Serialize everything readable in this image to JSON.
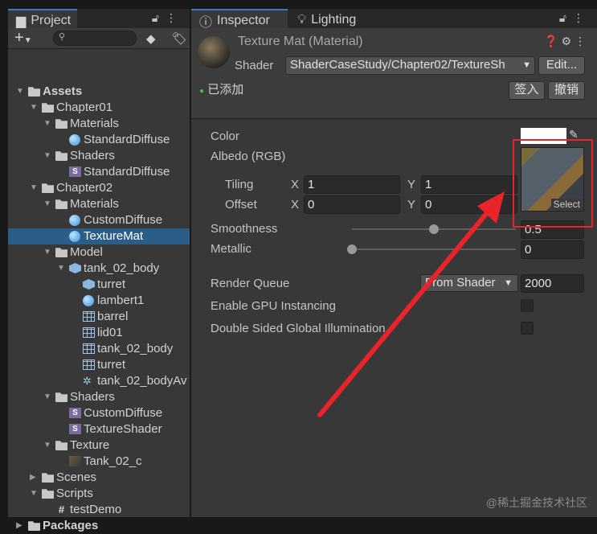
{
  "project": {
    "tab": "Project",
    "search_placeholder": "",
    "tree": [
      {
        "label": "Assets",
        "level": 0,
        "arrow": "open",
        "icon": "folder",
        "bold": true
      },
      {
        "label": "Chapter01",
        "level": 1,
        "arrow": "open",
        "icon": "folder"
      },
      {
        "label": "Materials",
        "level": 2,
        "arrow": "open",
        "icon": "folder"
      },
      {
        "label": "StandardDiffuse",
        "level": 3,
        "icon": "material"
      },
      {
        "label": "Shaders",
        "level": 2,
        "arrow": "open",
        "icon": "folder"
      },
      {
        "label": "StandardDiffuse",
        "level": 3,
        "icon": "shader"
      },
      {
        "label": "Chapter02",
        "level": 1,
        "arrow": "open",
        "icon": "folder"
      },
      {
        "label": "Materials",
        "level": 2,
        "arrow": "open",
        "icon": "folder"
      },
      {
        "label": "CustomDiffuse",
        "level": 3,
        "icon": "material"
      },
      {
        "label": "TextureMat",
        "level": 3,
        "icon": "material",
        "selected": true
      },
      {
        "label": "Model",
        "level": 2,
        "arrow": "open",
        "icon": "folder"
      },
      {
        "label": "tank_02_body",
        "level": 3,
        "arrow": "open",
        "icon": "prefab"
      },
      {
        "label": "turret",
        "level": 4,
        "icon": "prefab"
      },
      {
        "label": "lambert1",
        "level": 4,
        "icon": "material"
      },
      {
        "label": "barrel",
        "level": 4,
        "icon": "mesh"
      },
      {
        "label": "lid01",
        "level": 4,
        "icon": "mesh"
      },
      {
        "label": "tank_02_body",
        "level": 4,
        "icon": "mesh"
      },
      {
        "label": "turret",
        "level": 4,
        "icon": "mesh"
      },
      {
        "label": "tank_02_bodyAv",
        "level": 4,
        "icon": "avatar"
      },
      {
        "label": "Shaders",
        "level": 2,
        "arrow": "open",
        "icon": "folder"
      },
      {
        "label": "CustomDiffuse",
        "level": 3,
        "icon": "shader"
      },
      {
        "label": "TextureShader",
        "level": 3,
        "icon": "shader"
      },
      {
        "label": "Texture",
        "level": 2,
        "arrow": "open",
        "icon": "folder"
      },
      {
        "label": "Tank_02_c",
        "level": 3,
        "icon": "texture"
      },
      {
        "label": "Scenes",
        "level": 1,
        "arrow": "closed",
        "icon": "folder"
      },
      {
        "label": "Scripts",
        "level": 1,
        "arrow": "open",
        "icon": "folder"
      },
      {
        "label": "testDemo",
        "level": 2,
        "icon": "script"
      },
      {
        "label": "Packages",
        "level": 0,
        "arrow": "closed",
        "icon": "folder",
        "bold": true
      }
    ]
  },
  "inspector": {
    "tab_inspector": "Inspector",
    "tab_lighting": "Lighting",
    "title": "Texture Mat (Material)",
    "shader_label": "Shader",
    "shader_value": "ShaderCaseStudy/Chapter02/TextureSh",
    "edit_button": "Edit...",
    "status": "已添加",
    "checkin_button": "签入",
    "revert_button": "撤销",
    "color_label": "Color",
    "albedo_label": "Albedo (RGB)",
    "select_label": "Select",
    "tiling_label": "Tiling",
    "offset_label": "Offset",
    "x": "X",
    "y": "Y",
    "tiling_x": "1",
    "tiling_y": "1",
    "offset_x": "0",
    "offset_y": "0",
    "smoothness_label": "Smoothness",
    "smoothness_value": "0.5",
    "smoothness": 0.5,
    "metallic_label": "Metallic",
    "metallic_value": "0",
    "metallic": 0,
    "render_queue_label": "Render Queue",
    "render_queue_mode": "From Shader",
    "render_queue_value": "2000",
    "gpu_instancing_label": "Enable GPU Instancing",
    "double_sided_gi_label": "Double Sided Global Illumination",
    "gpu_instancing": false,
    "double_sided_gi": false
  },
  "watermark": "@稀土掘金技术社区",
  "colors": {
    "selection": "#2c5d87",
    "annotation": "#e8232a"
  }
}
